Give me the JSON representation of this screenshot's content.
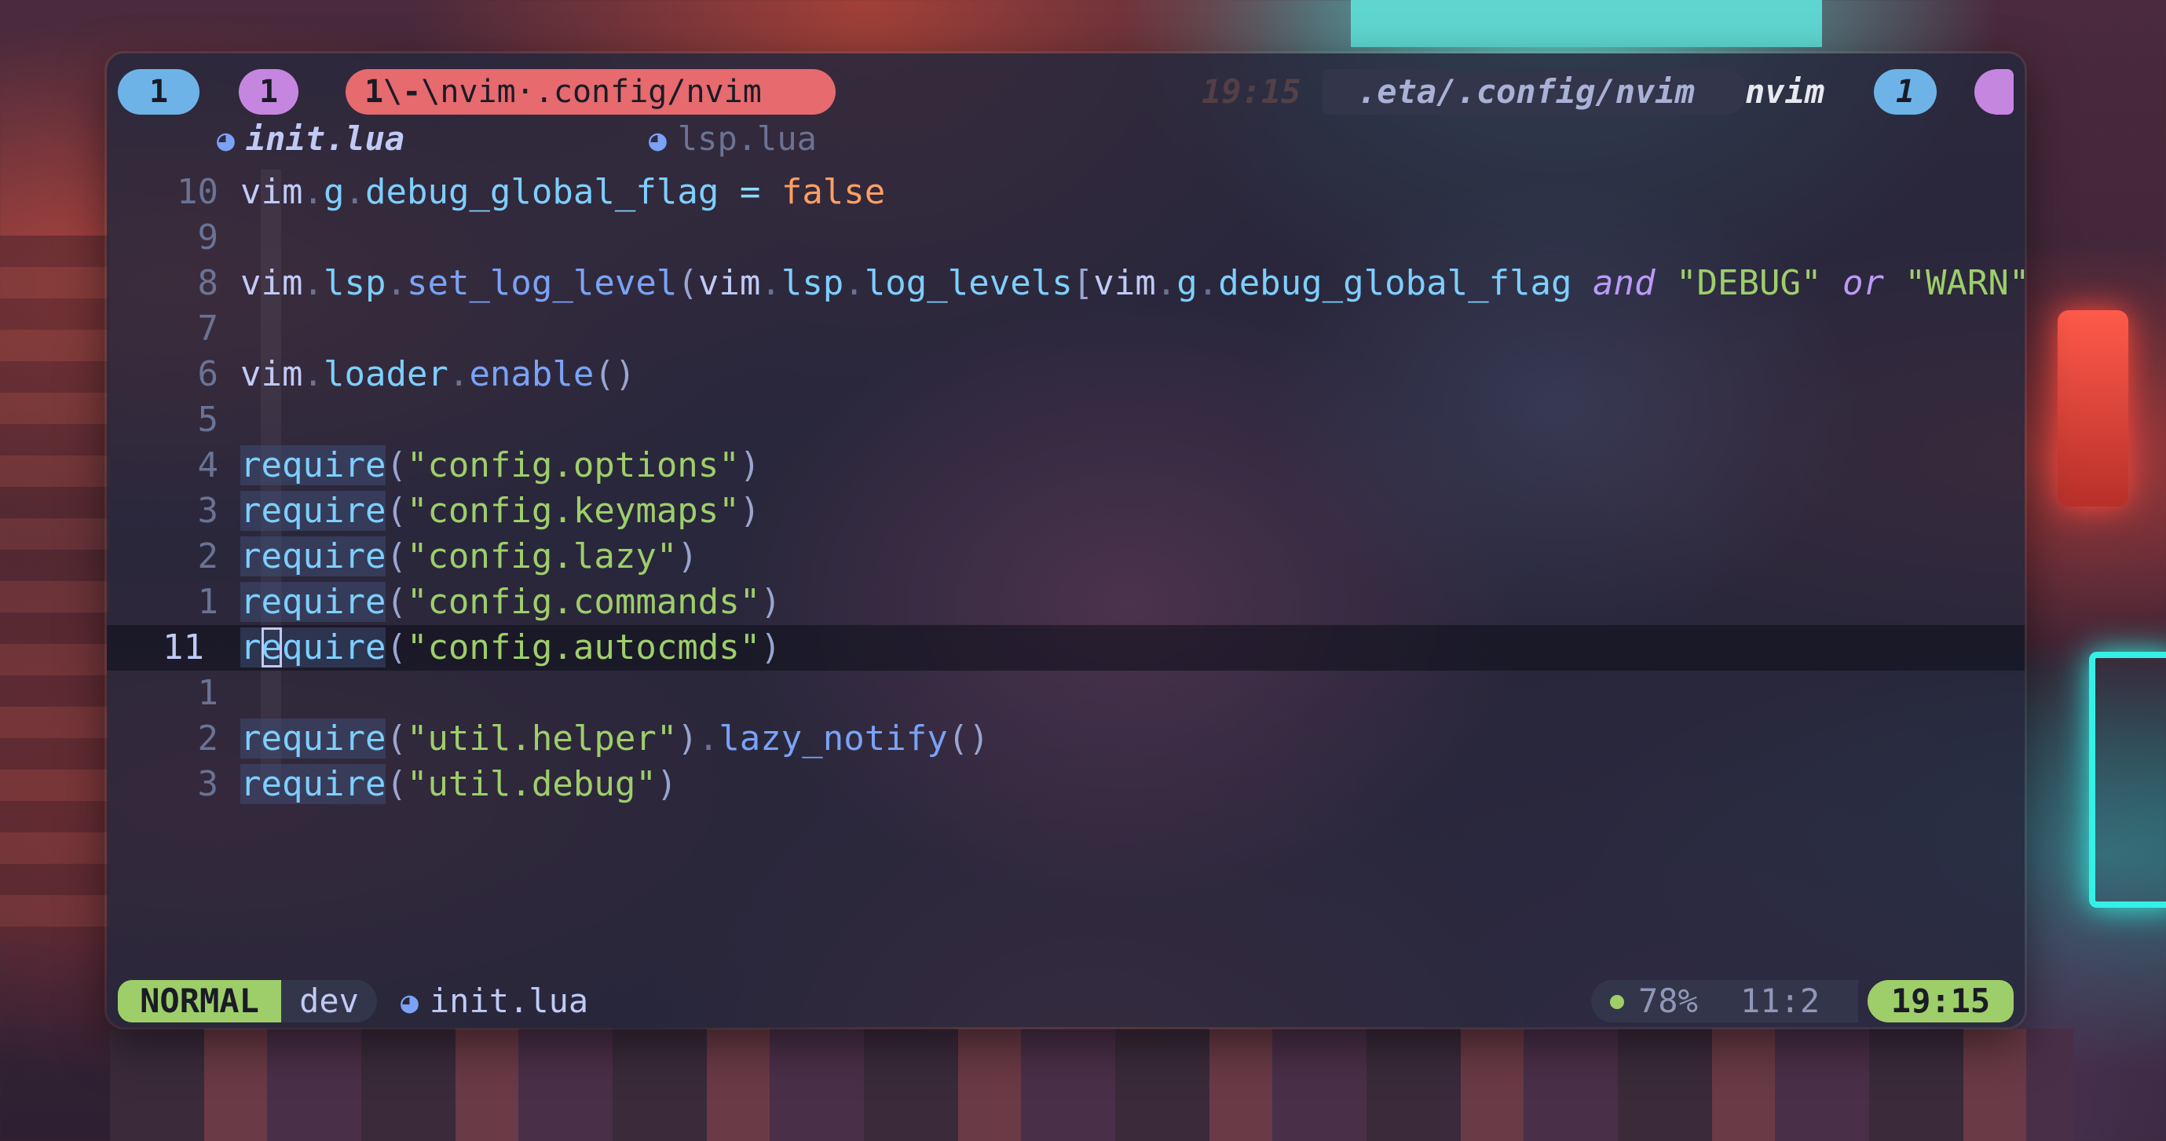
{
  "tabline": {
    "left_pill_1": "1",
    "left_pill_2": "1",
    "tab_number": "1",
    "tab_separator_a": "\\",
    "tab_dash": "-",
    "tab_separator_b": "\\",
    "tab_app": "nvim",
    "tab_dot": "·",
    "tab_path": ".config/nvim",
    "ghost_time": "19:15",
    "cwd": ".eta/.config/nvim",
    "app_name": "nvim",
    "right_pill_1": "1",
    "right_pill_2": ""
  },
  "buffers": [
    {
      "name": "init.lua",
      "active": true
    },
    {
      "name": "lsp.lua",
      "active": false
    }
  ],
  "editor": {
    "lines": [
      {
        "num": "10",
        "tokens": [
          [
            "vim",
            "id"
          ],
          [
            ".",
            "dot"
          ],
          [
            "g",
            "fld"
          ],
          [
            ".",
            "dot"
          ],
          [
            "debug_global_flag",
            "fld"
          ],
          [
            " ",
            "id"
          ],
          [
            "=",
            "op"
          ],
          [
            " ",
            "id"
          ],
          [
            "false",
            "bool"
          ]
        ]
      },
      {
        "num": "9",
        "tokens": []
      },
      {
        "num": "8",
        "tokens": [
          [
            "vim",
            "id"
          ],
          [
            ".",
            "dot"
          ],
          [
            "lsp",
            "fld"
          ],
          [
            ".",
            "dot"
          ],
          [
            "set_log_level",
            "fn"
          ],
          [
            "(",
            "par"
          ],
          [
            "vim",
            "id"
          ],
          [
            ".",
            "dot"
          ],
          [
            "lsp",
            "fld"
          ],
          [
            ".",
            "dot"
          ],
          [
            "log_levels",
            "fld"
          ],
          [
            "[",
            "par"
          ],
          [
            "vim",
            "id"
          ],
          [
            ".",
            "dot"
          ],
          [
            "g",
            "fld"
          ],
          [
            ".",
            "dot"
          ],
          [
            "debug_global_flag",
            "fld"
          ],
          [
            " ",
            "id"
          ],
          [
            "and",
            "kw"
          ],
          [
            " ",
            "id"
          ],
          [
            "\"DEBUG\"",
            "str"
          ],
          [
            " ",
            "id"
          ],
          [
            "or",
            "kw"
          ],
          [
            " ",
            "id"
          ],
          [
            "\"WARN\"",
            "str"
          ],
          [
            "]",
            "par"
          ]
        ]
      },
      {
        "num": "7",
        "tokens": []
      },
      {
        "num": "6",
        "tokens": [
          [
            "vim",
            "id"
          ],
          [
            ".",
            "dot"
          ],
          [
            "loader",
            "fld"
          ],
          [
            ".",
            "dot"
          ],
          [
            "enable",
            "fn"
          ],
          [
            "()",
            "par"
          ]
        ]
      },
      {
        "num": "5",
        "tokens": []
      },
      {
        "num": "4",
        "tokens": [
          [
            "require",
            "req"
          ],
          [
            "(",
            "par"
          ],
          [
            "\"config.options\"",
            "str"
          ],
          [
            ")",
            "par"
          ]
        ]
      },
      {
        "num": "3",
        "tokens": [
          [
            "require",
            "req"
          ],
          [
            "(",
            "par"
          ],
          [
            "\"config.keymaps\"",
            "str"
          ],
          [
            ")",
            "par"
          ]
        ]
      },
      {
        "num": "2",
        "tokens": [
          [
            "require",
            "req"
          ],
          [
            "(",
            "par"
          ],
          [
            "\"config.lazy\"",
            "str"
          ],
          [
            ")",
            "par"
          ]
        ]
      },
      {
        "num": "1",
        "tokens": [
          [
            "require",
            "req"
          ],
          [
            "(",
            "par"
          ],
          [
            "\"config.commands\"",
            "str"
          ],
          [
            ")",
            "par"
          ]
        ]
      },
      {
        "num": "11",
        "current": true,
        "tokens": [
          [
            "r",
            "req"
          ],
          [
            "e",
            "reqcur"
          ],
          [
            "quire",
            "req"
          ],
          [
            "(",
            "par"
          ],
          [
            "\"config.autocmds\"",
            "str"
          ],
          [
            ")",
            "par"
          ]
        ]
      },
      {
        "num": "1",
        "tokens": []
      },
      {
        "num": "2",
        "tokens": [
          [
            "require",
            "req"
          ],
          [
            "(",
            "par"
          ],
          [
            "\"util.helper\"",
            "str"
          ],
          [
            ")",
            "par"
          ],
          [
            ".",
            "dot"
          ],
          [
            "lazy_notify",
            "fn"
          ],
          [
            "()",
            "par"
          ]
        ]
      },
      {
        "num": "3",
        "tokens": [
          [
            "require",
            "req"
          ],
          [
            "(",
            "par"
          ],
          [
            "\"util.debug\"",
            "str"
          ],
          [
            ")",
            "par"
          ]
        ]
      }
    ]
  },
  "statusline": {
    "mode": "NORMAL",
    "branch": "dev",
    "file": "init.lua",
    "percent": "78%",
    "position": "11:2",
    "time": "19:15"
  },
  "colors": {
    "mode_bg": "#9ece6a",
    "tab_active_bg": "#e66a6e",
    "pill_blue": "#6db3e8",
    "pill_purple": "#c586e0",
    "string": "#9ece6a",
    "keyword": "#bb9af7",
    "function": "#7aa2f7",
    "boolean": "#ff9e64"
  },
  "icons": {
    "file": "lua-file-icon",
    "status": "ok-dot-icon"
  }
}
